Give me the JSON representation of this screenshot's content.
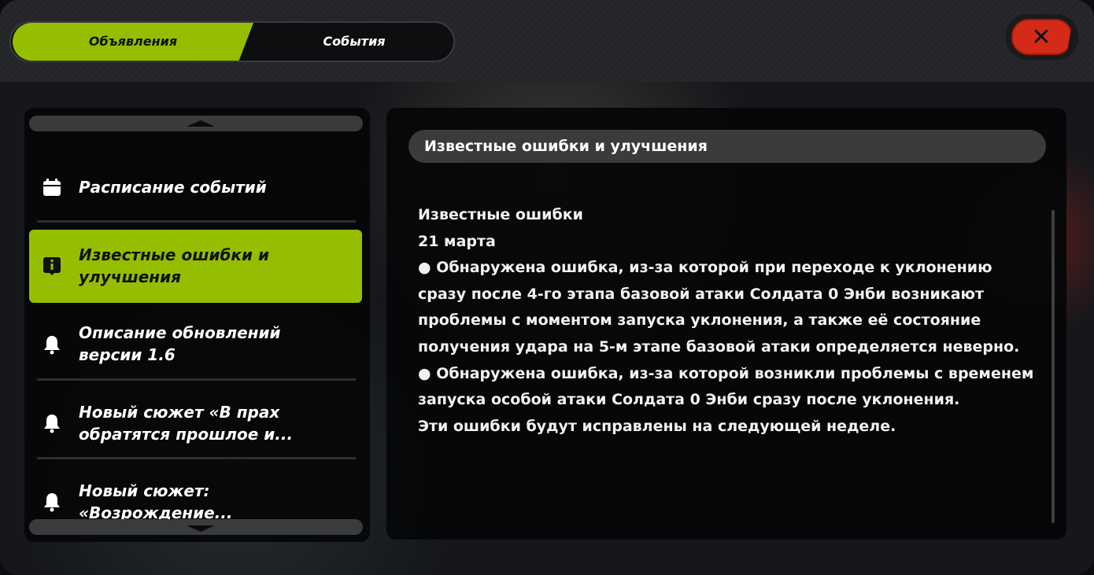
{
  "tabs": [
    {
      "label": "Объявления",
      "active": true
    },
    {
      "label": "События",
      "active": false
    }
  ],
  "close": {
    "icon": "close-icon"
  },
  "sidebar": {
    "items": [
      {
        "label": "Расписание событий",
        "icon": "calendar-icon",
        "active": false
      },
      {
        "label": "Известные ошибки и улучшения",
        "icon": "info-icon",
        "active": true
      },
      {
        "label": "Описание обновлений версии 1.6",
        "icon": "bell-icon",
        "active": false
      },
      {
        "label": "Новый сюжет «В прах обратятся прошлое и...",
        "icon": "bell-icon",
        "active": false
      },
      {
        "label": "Новый сюжет: «Возрождение...",
        "icon": "bell-icon",
        "active": false
      }
    ]
  },
  "content": {
    "title": "Известные ошибки и улучшения",
    "heading": "Известные ошибки",
    "date": "21 марта",
    "bullets": [
      "● Обнаружена ошибка, из-за которой при переходе к уклонению сразу после 4-го этапа базовой атаки Солдата 0 Энби возникают проблемы с моментом запуска уклонения, а также её состояние получения удара на 5-м этапе базовой атаки определяется неверно.",
      "● Обнаружена ошибка, из-за которой возникли проблемы с временем запуска особой атаки Солдата 0 Энби сразу после уклонения."
    ],
    "footer": "Эти ошибки будут исправлены на следующей неделе."
  },
  "colors": {
    "accent": "#96be00",
    "close": "#d42a18",
    "panel": "#050607"
  }
}
